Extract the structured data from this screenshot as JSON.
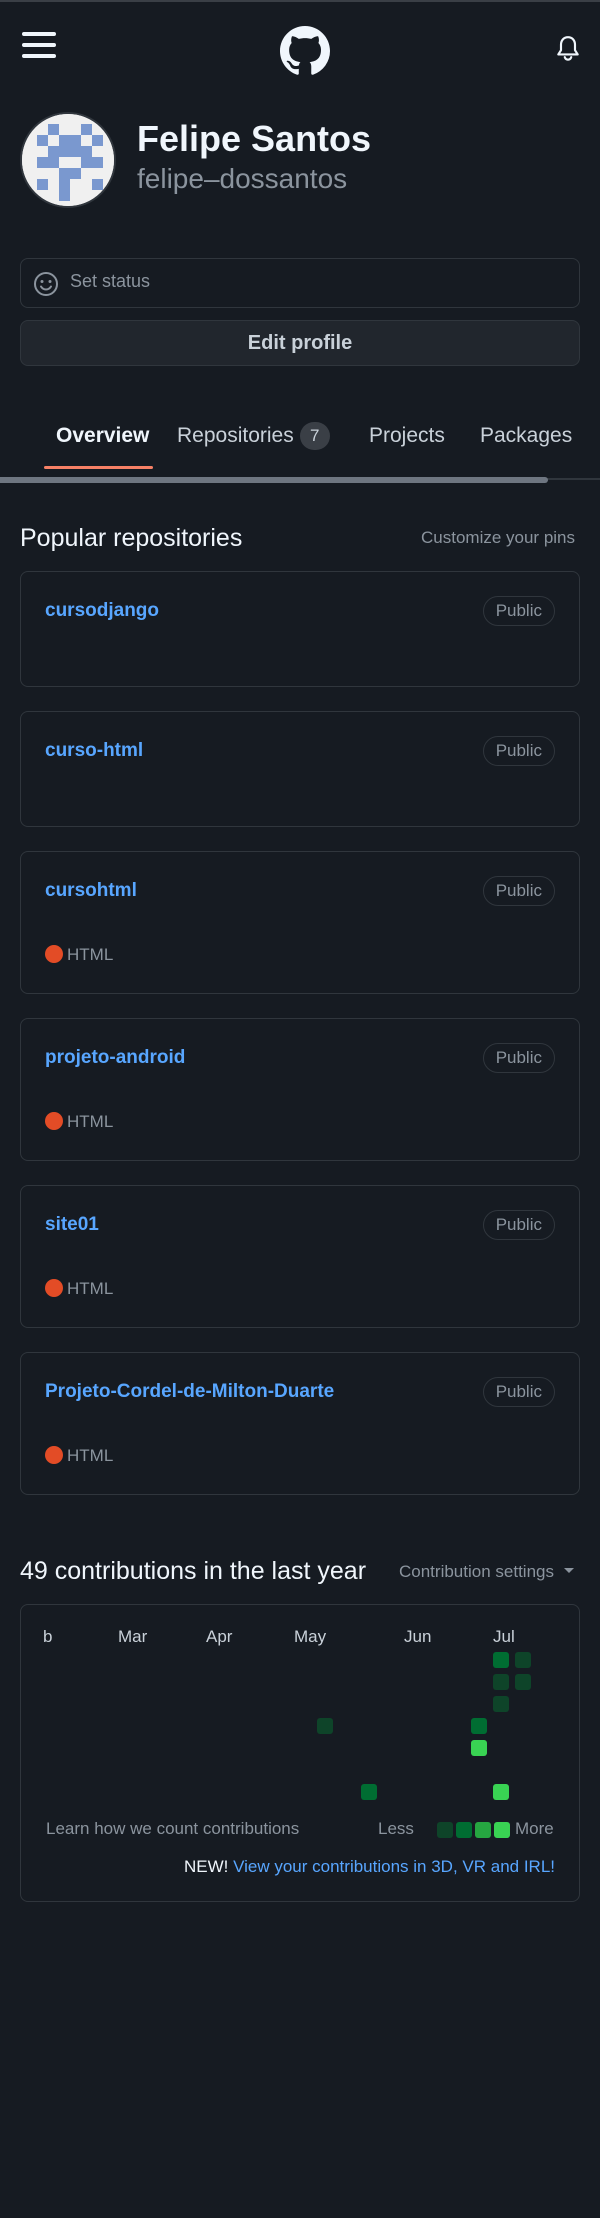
{
  "header": {
    "menu_icon": "hamburger-menu-icon",
    "logo_icon": "github-octocat-icon",
    "notifications_icon": "bell-icon"
  },
  "profile": {
    "display_name": "Felipe Santos",
    "username": "felipe–dossantos",
    "set_status": "Set status",
    "edit_profile": "Edit profile"
  },
  "tabs": [
    {
      "label": "Overview",
      "active": true
    },
    {
      "label": "Repositories",
      "count": "7"
    },
    {
      "label": "Projects"
    },
    {
      "label": "Packages"
    }
  ],
  "popular": {
    "title": "Popular repositories",
    "customize": "Customize your pins",
    "repos": [
      {
        "name": "cursodjango",
        "visibility": "Public",
        "language": ""
      },
      {
        "name": "curso-html",
        "visibility": "Public",
        "language": ""
      },
      {
        "name": "cursohtml",
        "visibility": "Public",
        "language": "HTML"
      },
      {
        "name": "projeto-android",
        "visibility": "Public",
        "language": "HTML"
      },
      {
        "name": "site01",
        "visibility": "Public",
        "language": "HTML"
      },
      {
        "name": "Projeto-Cordel-de-Milton-Duarte",
        "visibility": "Public",
        "language": "HTML"
      }
    ],
    "language_color": "#e34c26"
  },
  "contributions": {
    "title": "49 contributions in the last year",
    "settings": "Contribution settings",
    "months": [
      "b",
      "Mar",
      "Apr",
      "May",
      "Jun",
      "Jul"
    ],
    "learn": "Learn how we count contributions",
    "less": "Less",
    "more": "More",
    "new_label": "NEW!",
    "new_link": "View your contributions in 3D, VR and IRL!",
    "colors": [
      "#0e4429",
      "#006d32",
      "#26a641",
      "#39d353"
    ]
  }
}
